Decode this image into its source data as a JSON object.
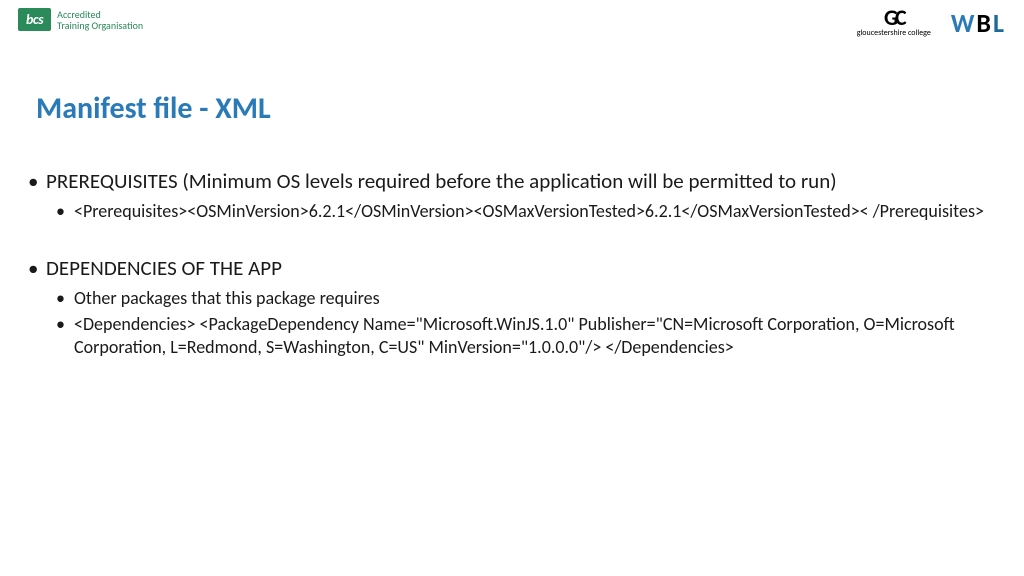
{
  "header": {
    "bcs": {
      "badge": "bcs",
      "line1": "Accredited",
      "line2": "Training Organisation"
    },
    "gc": {
      "symbol": "GC",
      "text": "gloucestershire college"
    },
    "wbl": {
      "w": "W",
      "b": "B",
      "l": "L"
    }
  },
  "title": "Manifest file  - XML",
  "bullets": {
    "prereq_title": "PREREQUISITES (Minimum OS levels required before the application will be permitted to run)",
    "prereq_code": "<Prerequisites><OSMinVersion>6.2.1</OSMinVersion><OSMaxVersionTested>6.2.1</OSMaxVersionTested>< /Prerequisites>",
    "deps_title": "DEPENDENCIES OF THE APP",
    "deps_sub1": "Other packages that this package requires",
    "deps_sub2": "<Dependencies> <PackageDependency Name=\"Microsoft.WinJS.1.0\" Publisher=\"CN=Microsoft Corporation, O=Microsoft Corporation, L=Redmond, S=Washington, C=US\" MinVersion=\"1.0.0.0\"/> </Dependencies>"
  }
}
